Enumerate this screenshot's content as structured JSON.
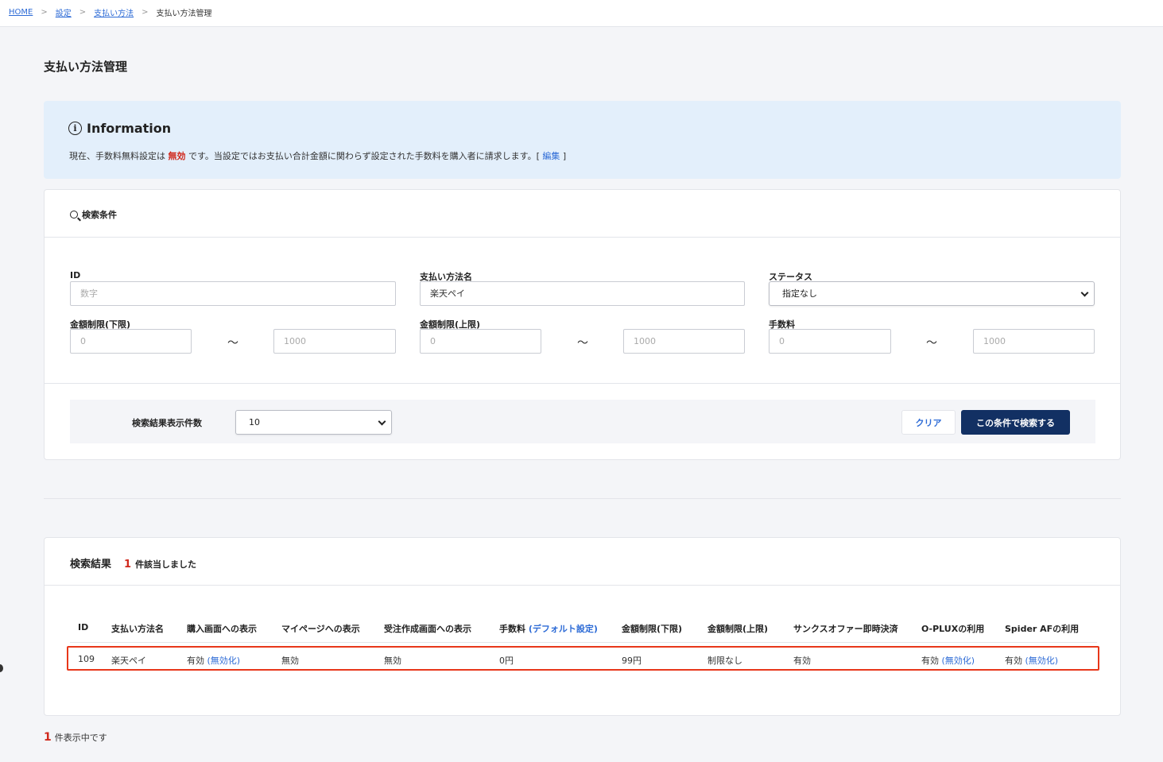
{
  "breadcrumb": {
    "home": "HOME",
    "settings": "設定",
    "payment_methods": "支払い方法",
    "current": "支払い方法管理",
    "separator": ">"
  },
  "page_title": "支払い方法管理",
  "info": {
    "icon": "info-icon",
    "title": "Information",
    "text_prefix": "現在、手数料無料設定は",
    "status": "無効",
    "text_suffix": "です。当設定ではお支払い合計金額に関わらず設定された手数料を購入者に請求します。[",
    "edit_link": "編集",
    "text_close": "]"
  },
  "search": {
    "title": "検索条件",
    "id_label": "ID",
    "id_placeholder": "数字",
    "name_label": "支払い方法名",
    "name_value": "楽天ペイ",
    "status_label": "ステータス",
    "status_value": "指定なし",
    "min_label": "金額制限(下限)",
    "max_label": "金額制限(上限)",
    "fee_label": "手数料",
    "range_from_placeholder": "0",
    "range_to_placeholder": "1000",
    "tilde": "〜",
    "per_page_label": "検索結果表示件数",
    "per_page_value": "10",
    "clear_button": "クリア",
    "search_button": "この条件で検索する"
  },
  "results": {
    "title": "検索結果",
    "count": "1",
    "count_suffix": "件該当しました",
    "columns": {
      "id": "ID",
      "name": "支払い方法名",
      "purchase_display": "購入画面への表示",
      "mypage_display": "マイページへの表示",
      "order_display": "受注作成画面への表示",
      "fee": "手数料",
      "fee_default_link": "(デフォルト設定)",
      "min": "金額制限(下限)",
      "max": "金額制限(上限)",
      "thanks_offer": "サンクスオファー即時決済",
      "oplux": "O-PLUXの利用",
      "spider": "Spider AFの利用"
    },
    "row": {
      "id": "109",
      "name": "楽天ペイ",
      "purchase_display": "有効",
      "purchase_action": "(無効化)",
      "mypage_display": "無効",
      "order_display": "無効",
      "fee": "0円",
      "min": "99円",
      "max": "制限なし",
      "thanks_offer": "有効",
      "oplux": "有効",
      "oplux_action": "(無効化)",
      "spider": "有効",
      "spider_action": "(無効化)"
    }
  },
  "footer": {
    "count": "1",
    "text": "件表示中です"
  },
  "colors": {
    "accent_blue": "#2d6bd6",
    "primary_button": "#123063",
    "alert_red": "#d0281c",
    "highlight_outline": "#e8371a",
    "info_background": "#e3effb"
  }
}
